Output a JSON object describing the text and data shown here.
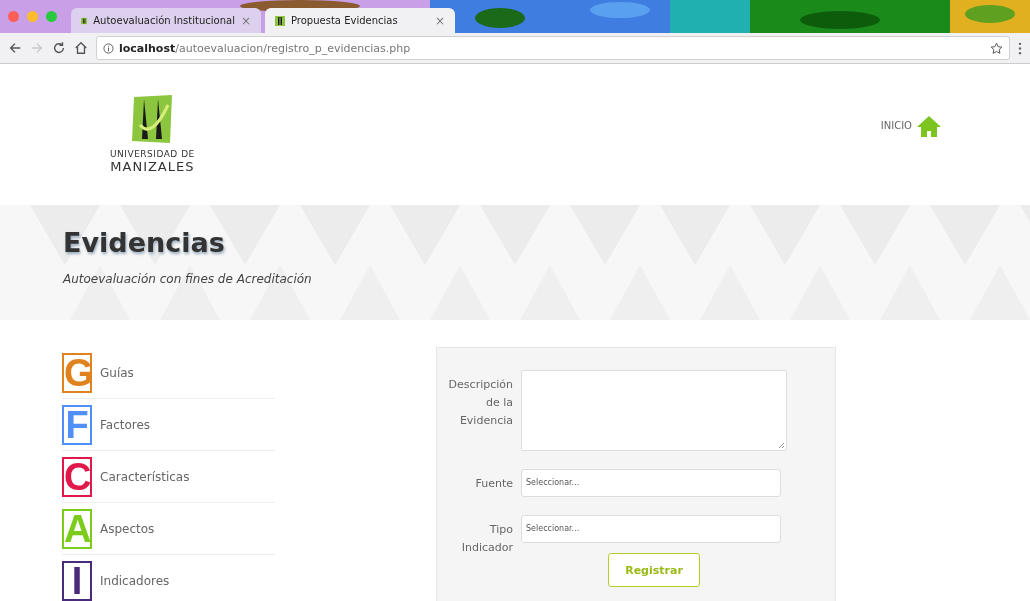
{
  "browser": {
    "tabs": [
      {
        "title": "Autoevaluación Institucional",
        "close": "×",
        "selected": false
      },
      {
        "title": "Propuesta Evidencias",
        "close": "×",
        "selected": true
      }
    ],
    "url": {
      "host": "localhost",
      "path": "/autoevaluacion/registro_p_evidencias.php"
    }
  },
  "header": {
    "logo_lines": [
      "UNIVERSIDAD DE",
      "MANIZALES"
    ],
    "home_link": "INICIO"
  },
  "banner": {
    "title": "Evidencias",
    "subtitle": "Autoevaluación con fines de Acreditación"
  },
  "sidebar": {
    "items": [
      {
        "letter": "G",
        "label": "Guías",
        "color": "#e0821e"
      },
      {
        "letter": "F",
        "label": "Factores",
        "color": "#4f8ff7"
      },
      {
        "letter": "C",
        "label": "Características",
        "color": "#e0194a"
      },
      {
        "letter": "A",
        "label": "Aspectos",
        "color": "#7ccc1c"
      },
      {
        "letter": "I",
        "label": "Indicadores",
        "color": "#4a2a7a"
      }
    ]
  },
  "form": {
    "fields": [
      {
        "kind": "textarea",
        "label": "Descripción de la Evidencia"
      },
      {
        "kind": "select",
        "label": "Fuente",
        "placeholder": "Seleccionar..."
      },
      {
        "kind": "select",
        "label": "Tipo Indicador",
        "placeholder": "Seleccionar..."
      }
    ],
    "submit": "Registrar"
  }
}
